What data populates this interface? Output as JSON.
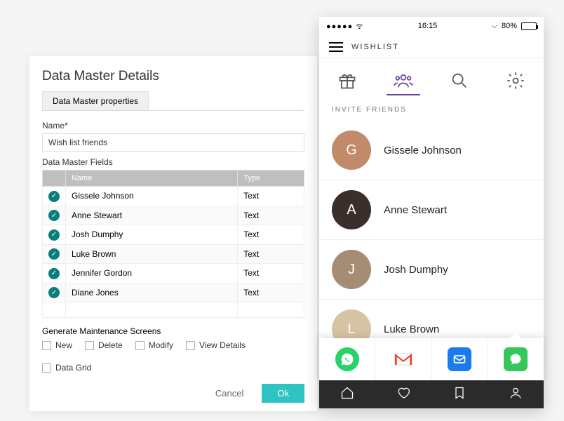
{
  "dialog": {
    "title": "Data Master Details",
    "tab": "Data Master properties",
    "name_label": "Name*",
    "name_value": "Wish list friends",
    "fields_label": "Data Master Fields",
    "col_name": "Name",
    "col_type": "Type",
    "rows": [
      {
        "name": "Gissele Johnson",
        "type": "Text"
      },
      {
        "name": "Anne Stewart",
        "type": "Text"
      },
      {
        "name": "Josh Dumphy",
        "type": "Text"
      },
      {
        "name": "Luke Brown",
        "type": "Text"
      },
      {
        "name": "Jennifer Gordon",
        "type": "Text"
      },
      {
        "name": "Diane Jones",
        "type": "Text"
      }
    ],
    "gen_label": "Generate Maintenance Screens",
    "checks": [
      "New",
      "Delete",
      "Modify",
      "View Details",
      "Data Grid"
    ],
    "cancel": "Cancel",
    "ok": "Ok"
  },
  "phone": {
    "time": "16:15",
    "battery_pct": "80%",
    "app_title": "WISHLIST",
    "section": "INVITE FRIENDS",
    "friends": [
      {
        "name": "Gissele Johnson",
        "av_bg": "#c08a6b",
        "initial": "G"
      },
      {
        "name": "Anne Stewart",
        "av_bg": "#3a2f2a",
        "initial": "A"
      },
      {
        "name": "Josh Dumphy",
        "av_bg": "#a58c74",
        "initial": "J"
      },
      {
        "name": "Luke Brown",
        "av_bg": "#d8c3a5",
        "initial": "L"
      }
    ]
  }
}
